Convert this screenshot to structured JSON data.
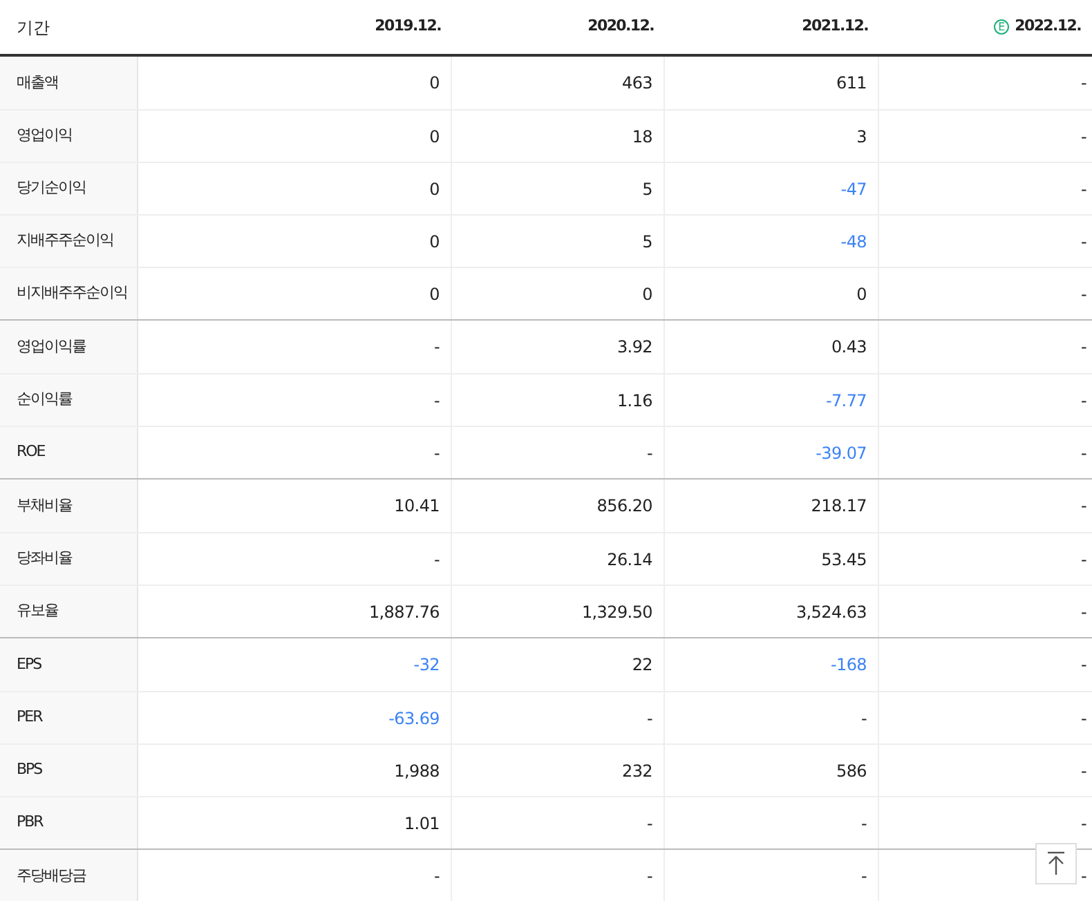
{
  "header": {
    "label": "기간",
    "columns": [
      {
        "text": "2019.12."
      },
      {
        "text": "2020.12."
      },
      {
        "text": "2021.12."
      },
      {
        "text": "2022.12.",
        "badge": "E"
      }
    ]
  },
  "groups": [
    {
      "rows": [
        {
          "label": "매출액",
          "cells": [
            {
              "text": "0",
              "negative": false
            },
            {
              "text": "463",
              "negative": false
            },
            {
              "text": "611",
              "negative": false
            },
            {
              "text": "-",
              "negative": false
            }
          ]
        },
        {
          "label": "영업이익",
          "cells": [
            {
              "text": "0",
              "negative": false
            },
            {
              "text": "18",
              "negative": false
            },
            {
              "text": "3",
              "negative": false
            },
            {
              "text": "-",
              "negative": false
            }
          ]
        },
        {
          "label": "당기순이익",
          "cells": [
            {
              "text": "0",
              "negative": false
            },
            {
              "text": "5",
              "negative": false
            },
            {
              "text": "-47",
              "negative": true
            },
            {
              "text": "-",
              "negative": false
            }
          ]
        },
        {
          "label": "지배주주순이익",
          "cells": [
            {
              "text": "0",
              "negative": false
            },
            {
              "text": "5",
              "negative": false
            },
            {
              "text": "-48",
              "negative": true
            },
            {
              "text": "-",
              "negative": false
            }
          ]
        },
        {
          "label": "비지배주주순이익",
          "cells": [
            {
              "text": "0",
              "negative": false
            },
            {
              "text": "0",
              "negative": false
            },
            {
              "text": "0",
              "negative": false
            },
            {
              "text": "-",
              "negative": false
            }
          ]
        }
      ]
    },
    {
      "rows": [
        {
          "label": "영업이익률",
          "cells": [
            {
              "text": "-",
              "negative": false
            },
            {
              "text": "3.92",
              "negative": false
            },
            {
              "text": "0.43",
              "negative": false
            },
            {
              "text": "-",
              "negative": false
            }
          ]
        },
        {
          "label": "순이익률",
          "cells": [
            {
              "text": "-",
              "negative": false
            },
            {
              "text": "1.16",
              "negative": false
            },
            {
              "text": "-7.77",
              "negative": true
            },
            {
              "text": "-",
              "negative": false
            }
          ]
        },
        {
          "label": "ROE",
          "cells": [
            {
              "text": "-",
              "negative": false
            },
            {
              "text": "-",
              "negative": false
            },
            {
              "text": "-39.07",
              "negative": true
            },
            {
              "text": "-",
              "negative": false
            }
          ]
        }
      ]
    },
    {
      "rows": [
        {
          "label": "부채비율",
          "cells": [
            {
              "text": "10.41",
              "negative": false
            },
            {
              "text": "856.20",
              "negative": false
            },
            {
              "text": "218.17",
              "negative": false
            },
            {
              "text": "-",
              "negative": false
            }
          ]
        },
        {
          "label": "당좌비율",
          "cells": [
            {
              "text": "-",
              "negative": false
            },
            {
              "text": "26.14",
              "negative": false
            },
            {
              "text": "53.45",
              "negative": false
            },
            {
              "text": "-",
              "negative": false
            }
          ]
        },
        {
          "label": "유보율",
          "cells": [
            {
              "text": "1,887.76",
              "negative": false
            },
            {
              "text": "1,329.50",
              "negative": false
            },
            {
              "text": "3,524.63",
              "negative": false
            },
            {
              "text": "-",
              "negative": false
            }
          ]
        }
      ]
    },
    {
      "rows": [
        {
          "label": "EPS",
          "cells": [
            {
              "text": "-32",
              "negative": true
            },
            {
              "text": "22",
              "negative": false
            },
            {
              "text": "-168",
              "negative": true
            },
            {
              "text": "-",
              "negative": false
            }
          ]
        },
        {
          "label": "PER",
          "cells": [
            {
              "text": "-63.69",
              "negative": true
            },
            {
              "text": "-",
              "negative": false
            },
            {
              "text": "-",
              "negative": false
            },
            {
              "text": "-",
              "negative": false
            }
          ]
        },
        {
          "label": "BPS",
          "cells": [
            {
              "text": "1,988",
              "negative": false
            },
            {
              "text": "232",
              "negative": false
            },
            {
              "text": "586",
              "negative": false
            },
            {
              "text": "-",
              "negative": false
            }
          ]
        },
        {
          "label": "PBR",
          "cells": [
            {
              "text": "1.01",
              "negative": false
            },
            {
              "text": "-",
              "negative": false
            },
            {
              "text": "-",
              "negative": false
            },
            {
              "text": "-",
              "negative": false
            }
          ]
        }
      ]
    },
    {
      "rows": [
        {
          "label": "주당배당금",
          "cells": [
            {
              "text": "-",
              "negative": false
            },
            {
              "text": "-",
              "negative": false
            },
            {
              "text": "-",
              "negative": false
            },
            {
              "text": "-",
              "negative": false
            }
          ]
        }
      ]
    }
  ]
}
